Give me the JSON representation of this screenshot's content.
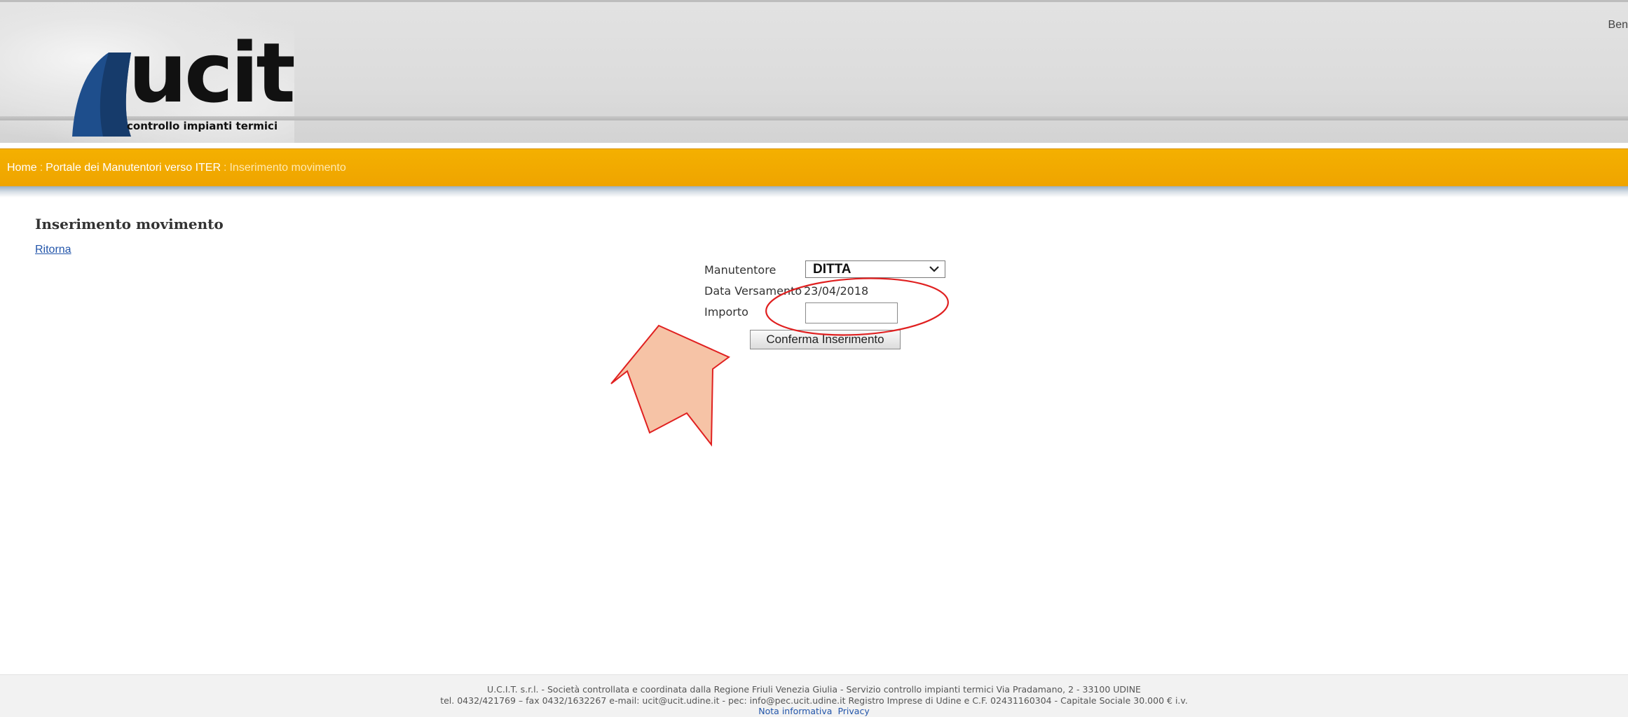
{
  "header": {
    "logo_text": "ucit",
    "logo_subtitle": "controllo impianti termici",
    "greeting": "Ben"
  },
  "breadcrumb": {
    "items": [
      "Home",
      "Portale dei Manutentori verso ITER",
      "Inserimento movimento"
    ],
    "separator": ":"
  },
  "page": {
    "title": "Inserimento movimento",
    "back_link": "Ritorna"
  },
  "form": {
    "manutentore_label": "Manutentore",
    "manutentore_value": "DITTA",
    "data_label": "Data Versamento",
    "data_value": "23/04/2018",
    "importo_label": "Importo",
    "importo_value": "",
    "submit_label": "Conferma Inserimento"
  },
  "footer": {
    "line1": "U.C.I.T. s.r.l. - Società controllata e coordinata dalla Regione Friuli Venezia Giulia - Servizio controllo impianti termici Via Pradamano, 2 - 33100 UDINE",
    "line2": "tel. 0432/421769 – fax 0432/1632267 e-mail: ucit@ucit.udine.it - pec: info@pec.ucit.udine.it Registro Imprese di Udine e C.F. 02431160304 - Capitale Sociale 30.000 € i.v.",
    "links": [
      "Nota informativa",
      "Privacy"
    ]
  },
  "annotations": {
    "highlight_color": "#e02020",
    "arrow_fill": "#f6c3a6",
    "arrow_stroke": "#e02020"
  }
}
